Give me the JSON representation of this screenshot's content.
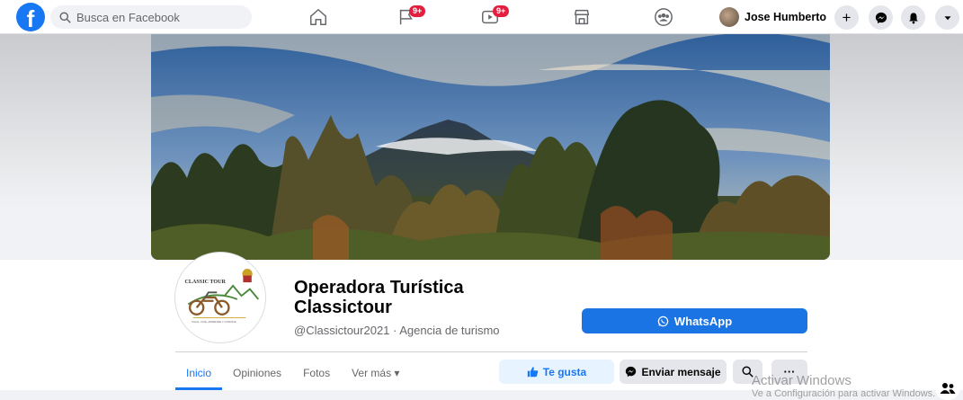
{
  "topbar": {
    "logo": "f",
    "search_placeholder": "Busca en Facebook",
    "nav": [
      {
        "name": "home",
        "badge": ""
      },
      {
        "name": "pages-flag",
        "badge": "9+"
      },
      {
        "name": "watch-video",
        "badge": "9+"
      },
      {
        "name": "marketplace",
        "badge": ""
      },
      {
        "name": "groups",
        "badge": ""
      }
    ],
    "profile_name": "Jose Humberto",
    "create_icon": "+"
  },
  "page": {
    "title": "Operadora Turística Classictour",
    "subtitle": "@Classictour2021 · Agencia de turismo",
    "logo_text_top": "CLASSIC TOUR",
    "logo_text_bottom": "VIAJA, VIVE, APRENDE Y CONOCE"
  },
  "actions": {
    "whatsapp": "WhatsApp",
    "like": "Te gusta",
    "message": "Enviar mensaje",
    "more": "···"
  },
  "tabs": [
    {
      "label": "Inicio",
      "active": true
    },
    {
      "label": "Opiniones",
      "active": false
    },
    {
      "label": "Fotos",
      "active": false
    },
    {
      "label": "Ver más ▾",
      "active": false
    }
  ],
  "watermark": {
    "line1": "Activar Windows",
    "line2": "Ve a Configuración para activar Windows."
  },
  "colors": {
    "brand": "#1877f2",
    "button_primary": "#1b74e4",
    "badge": "#e41e3f"
  }
}
